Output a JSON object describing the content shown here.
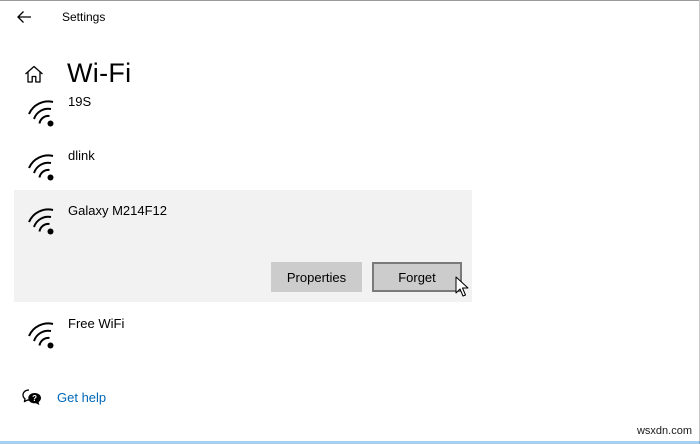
{
  "window": {
    "title": "Settings"
  },
  "page": {
    "title": "Wi-Fi"
  },
  "networks": [
    {
      "name": "19S",
      "icon": "wifi-signal-icon"
    },
    {
      "name": "dlink",
      "icon": "wifi-signal-icon"
    },
    {
      "name": "Galaxy M214F12",
      "icon": "wifi-signal-icon",
      "selected": true
    },
    {
      "name": "Free WiFi",
      "icon": "wifi-signal-icon"
    }
  ],
  "selected_actions": {
    "properties_label": "Properties",
    "forget_label": "Forget"
  },
  "help": {
    "label": "Get help",
    "icon": "help-chat-icon"
  },
  "watermark": "wsxdn.com",
  "colors": {
    "link": "#0067b8",
    "button": "#cccccc",
    "selected_row": "#f2f2f2",
    "focus_border": "#7a7a7a"
  }
}
